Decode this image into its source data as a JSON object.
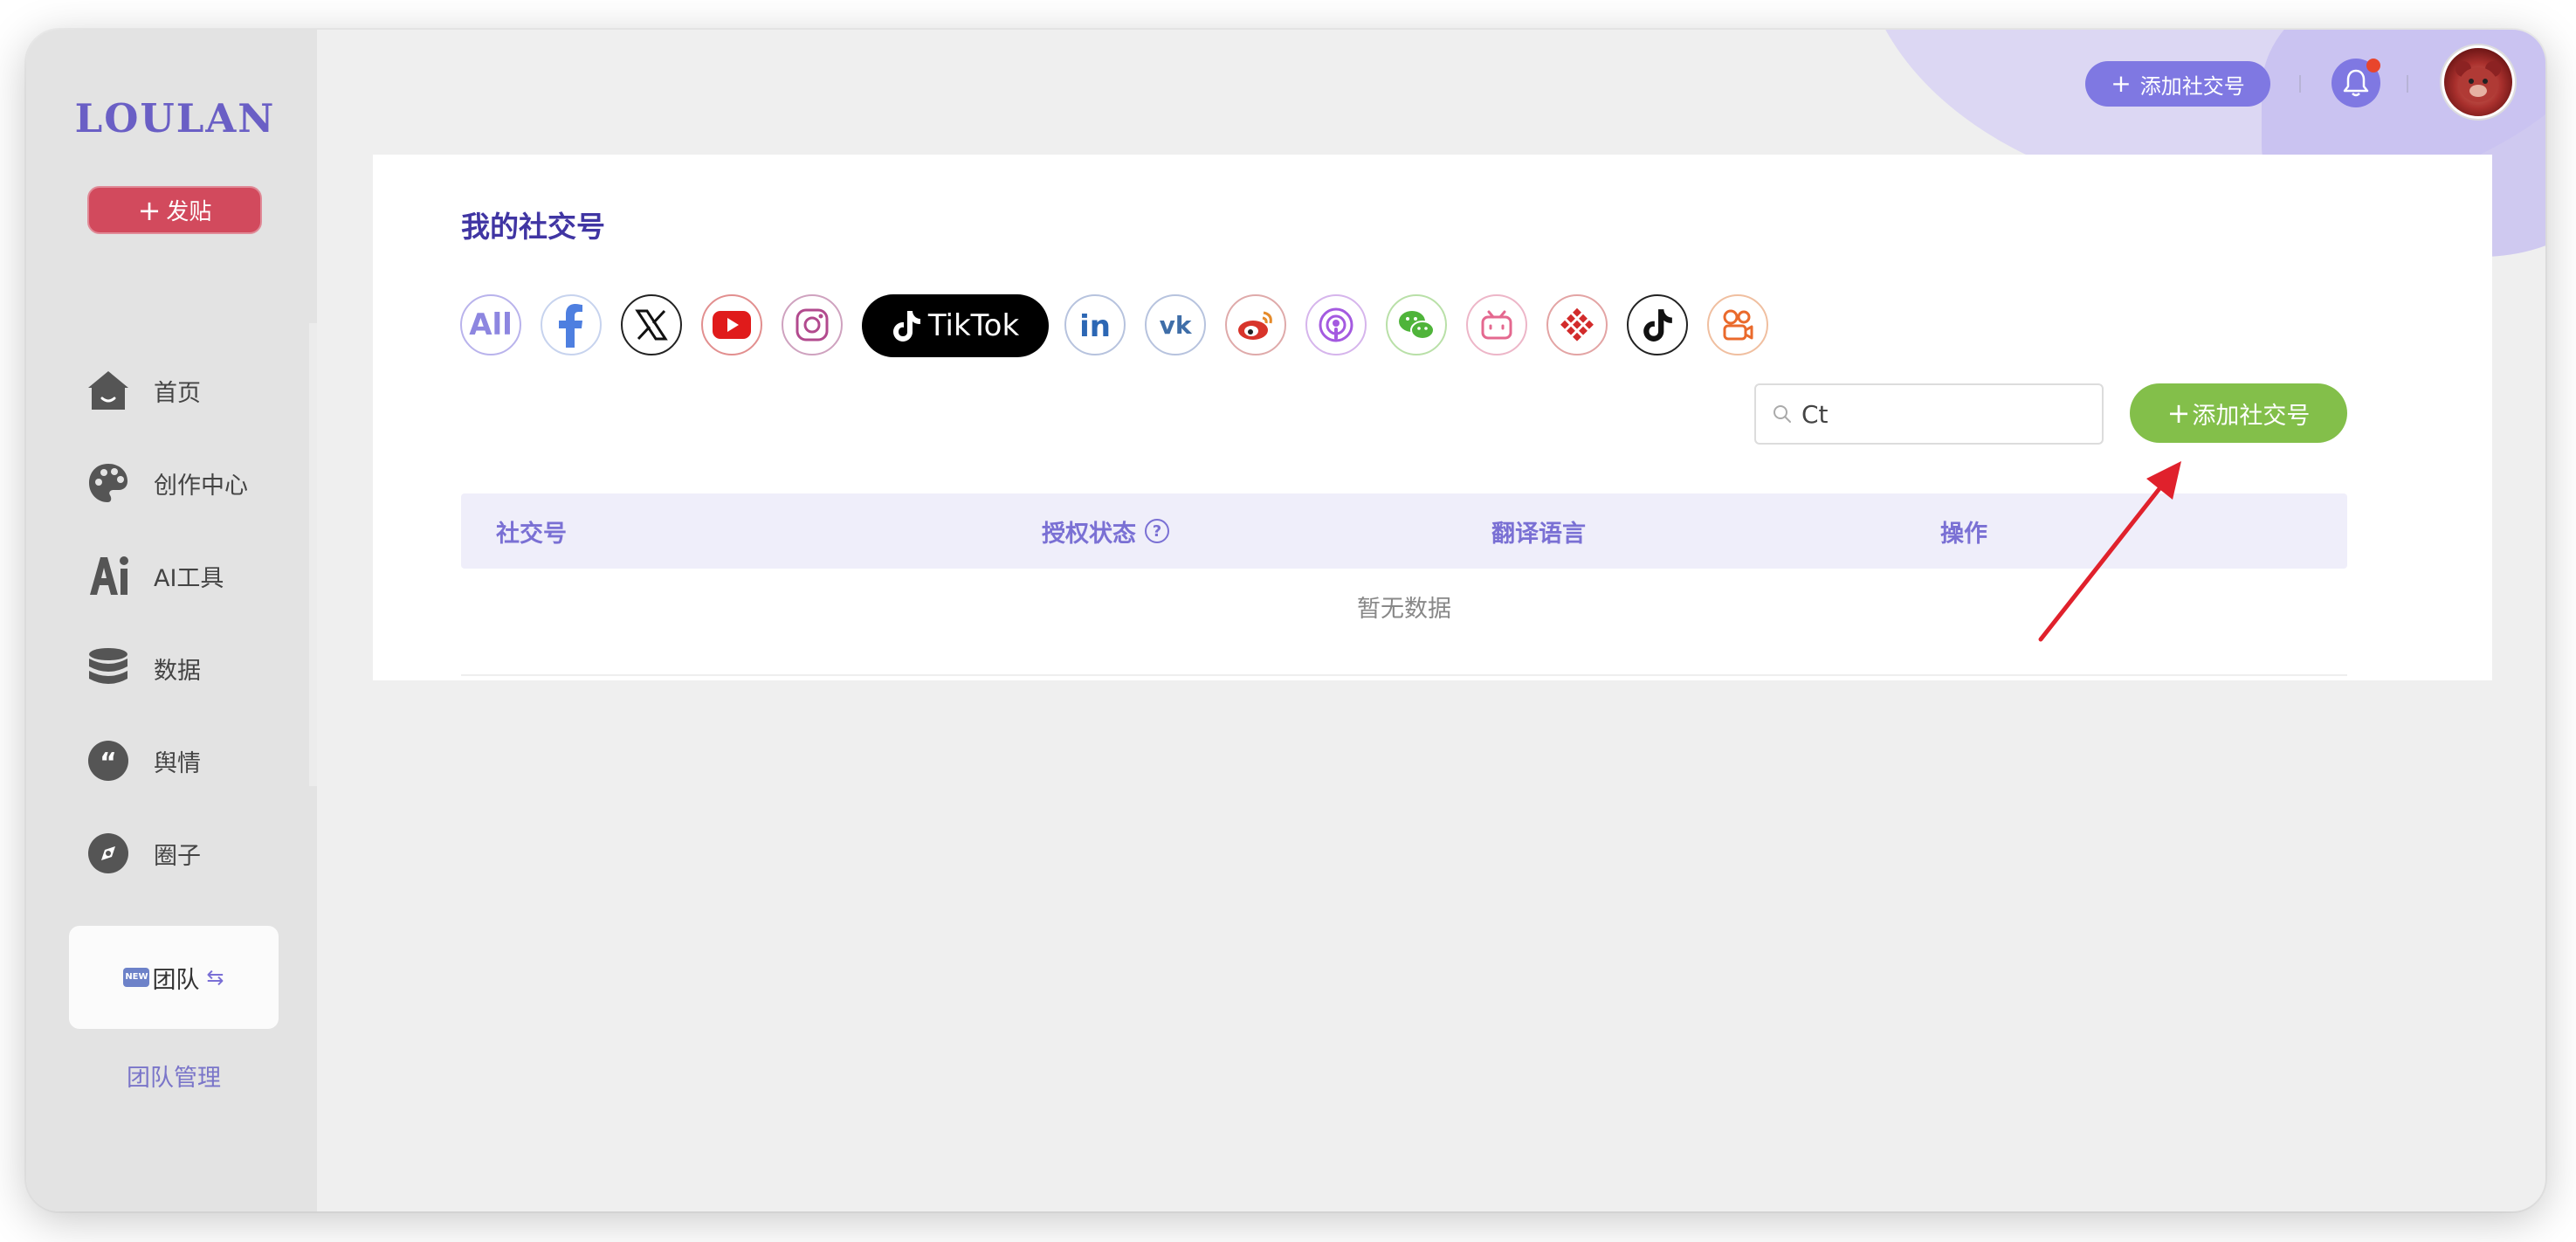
{
  "app": {
    "logo": "LOULAN",
    "post_button": "发贴",
    "nav": [
      {
        "label": "首页",
        "icon": "home-icon"
      },
      {
        "label": "创作中心",
        "icon": "palette-icon"
      },
      {
        "label": "AI工具",
        "icon": "ai-icon"
      },
      {
        "label": "数据",
        "icon": "database-icon"
      },
      {
        "label": "舆情",
        "icon": "quote-icon"
      },
      {
        "label": "圈子",
        "icon": "compass-icon"
      }
    ],
    "team_card": {
      "badge": "NEW",
      "label": "团队"
    },
    "team_manage": "团队管理"
  },
  "header": {
    "add_account_button": "添加社交号",
    "notification_dot": true
  },
  "main": {
    "title": "我的社交号",
    "filters": [
      {
        "name": "all",
        "label": "All"
      },
      {
        "name": "facebook"
      },
      {
        "name": "x"
      },
      {
        "name": "youtube"
      },
      {
        "name": "instagram"
      },
      {
        "name": "tiktok",
        "label": "TikTok"
      },
      {
        "name": "linkedin"
      },
      {
        "name": "vk"
      },
      {
        "name": "weibo"
      },
      {
        "name": "podcasts"
      },
      {
        "name": "wechat"
      },
      {
        "name": "bilibili"
      },
      {
        "name": "xigua"
      },
      {
        "name": "douyin"
      },
      {
        "name": "kuaishou"
      }
    ],
    "search": {
      "value": "Ct"
    },
    "add_button": "添加社交号",
    "table": {
      "columns": [
        "社交号",
        "授权状态",
        "翻译语言",
        "操作"
      ],
      "help_mark": "?",
      "empty_text": "暂无数据"
    }
  },
  "colors": {
    "accent": "#7f78e2",
    "title": "#4035a3",
    "post_button": "#d24a5d",
    "add_button": "#83bf4a",
    "annotation_arrow": "#e0212c"
  }
}
